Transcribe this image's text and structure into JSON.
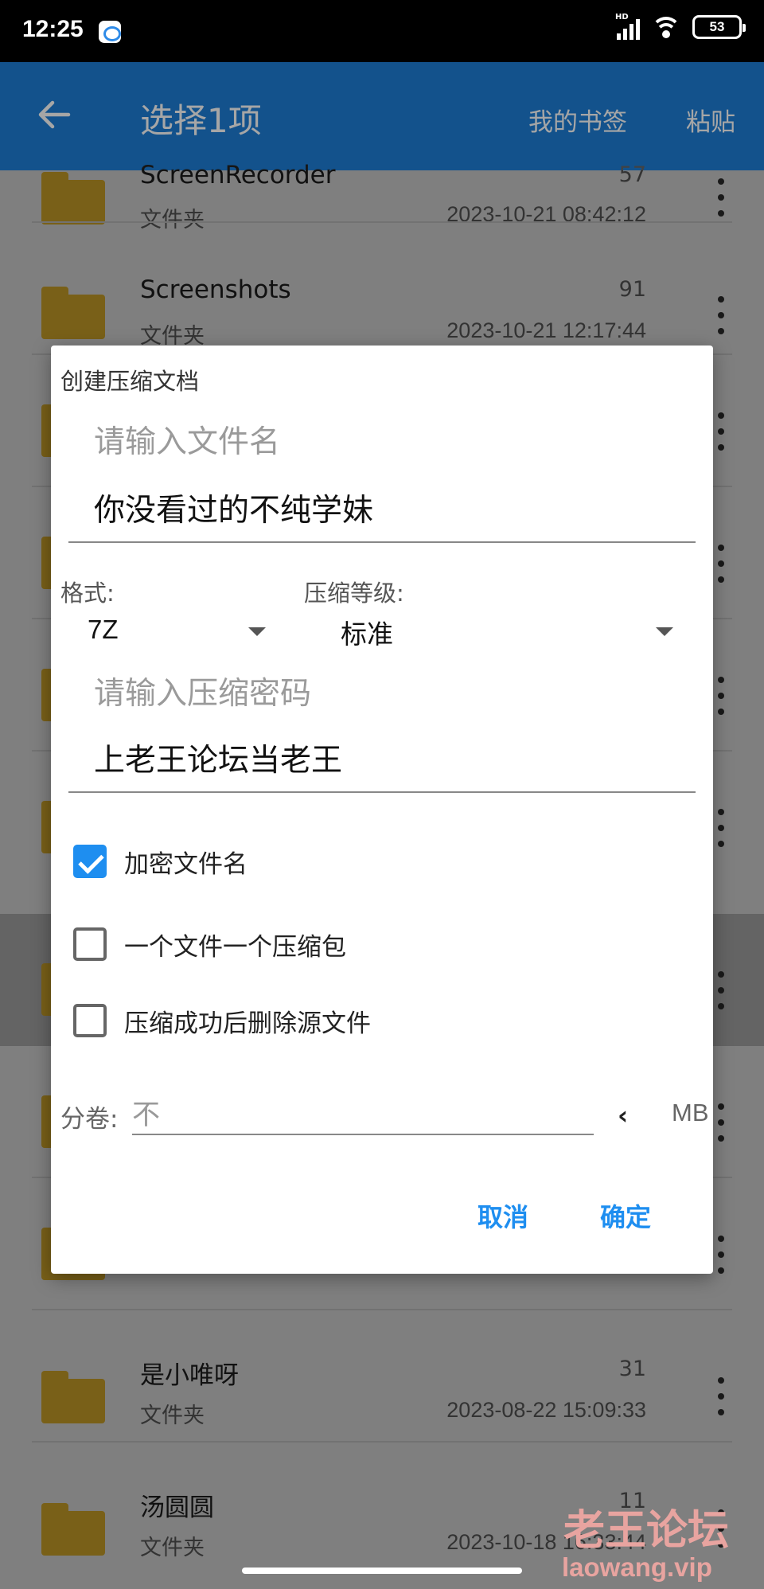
{
  "status_bar": {
    "time": "12:25",
    "network": "HD",
    "battery": "53"
  },
  "app_bar": {
    "title": "选择1项",
    "bookmarks_label": "我的书签",
    "paste_label": "粘贴"
  },
  "files": [
    {
      "name": "ScreenRecorder",
      "type": "文件夹",
      "count": "57",
      "date": "2023-10-21 08:42:12"
    },
    {
      "name": "Screenshots",
      "type": "文件夹",
      "count": "91",
      "date": "2023-10-21 12:17:44"
    },
    {
      "name": "是小唯呀",
      "type": "文件夹",
      "count": "31",
      "date": "2023-08-22 15:09:33"
    },
    {
      "name": "汤圆圆",
      "type": "文件夹",
      "count": "11",
      "date": "2023-10-18 16:33:44"
    }
  ],
  "dialog": {
    "title": "创建压缩文档",
    "filename_hint": "请输入文件名",
    "filename_value": "你没看过的不纯学妹",
    "format_label": "格式:",
    "format_value": "7Z",
    "level_label": "压缩等级:",
    "level_value": "标准",
    "password_hint": "请输入压缩密码",
    "password_value": "上老王论坛当老王",
    "options": [
      {
        "label": "加密文件名",
        "checked": true
      },
      {
        "label": "一个文件一个压缩包",
        "checked": false
      },
      {
        "label": "压缩成功后删除源文件",
        "checked": false
      }
    ],
    "split_label": "分卷:",
    "split_value": "不",
    "split_unit": "MB",
    "cancel_label": "取消",
    "ok_label": "确定"
  },
  "watermark": {
    "cn": "老王论坛",
    "en": "laowang.vip"
  },
  "colors": {
    "accent": "#1e8ef0",
    "app_bar": "#1e7ed8",
    "folder": "#f2c030"
  }
}
